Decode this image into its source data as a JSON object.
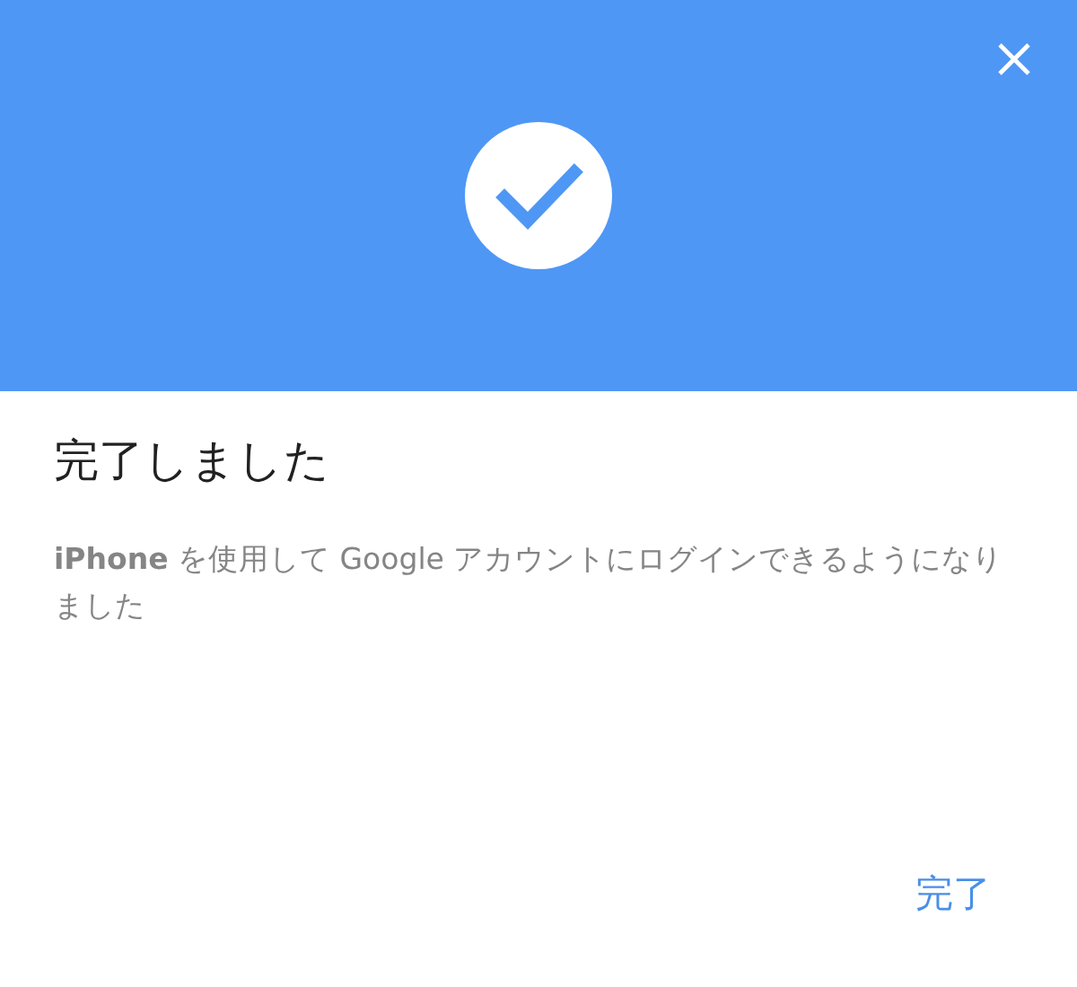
{
  "dialog": {
    "title": "完了しました",
    "message": "**iPhone** を使用して Google アカウントにログインできるようになりました",
    "buttons": [
      "完了"
    ]
  }
}
